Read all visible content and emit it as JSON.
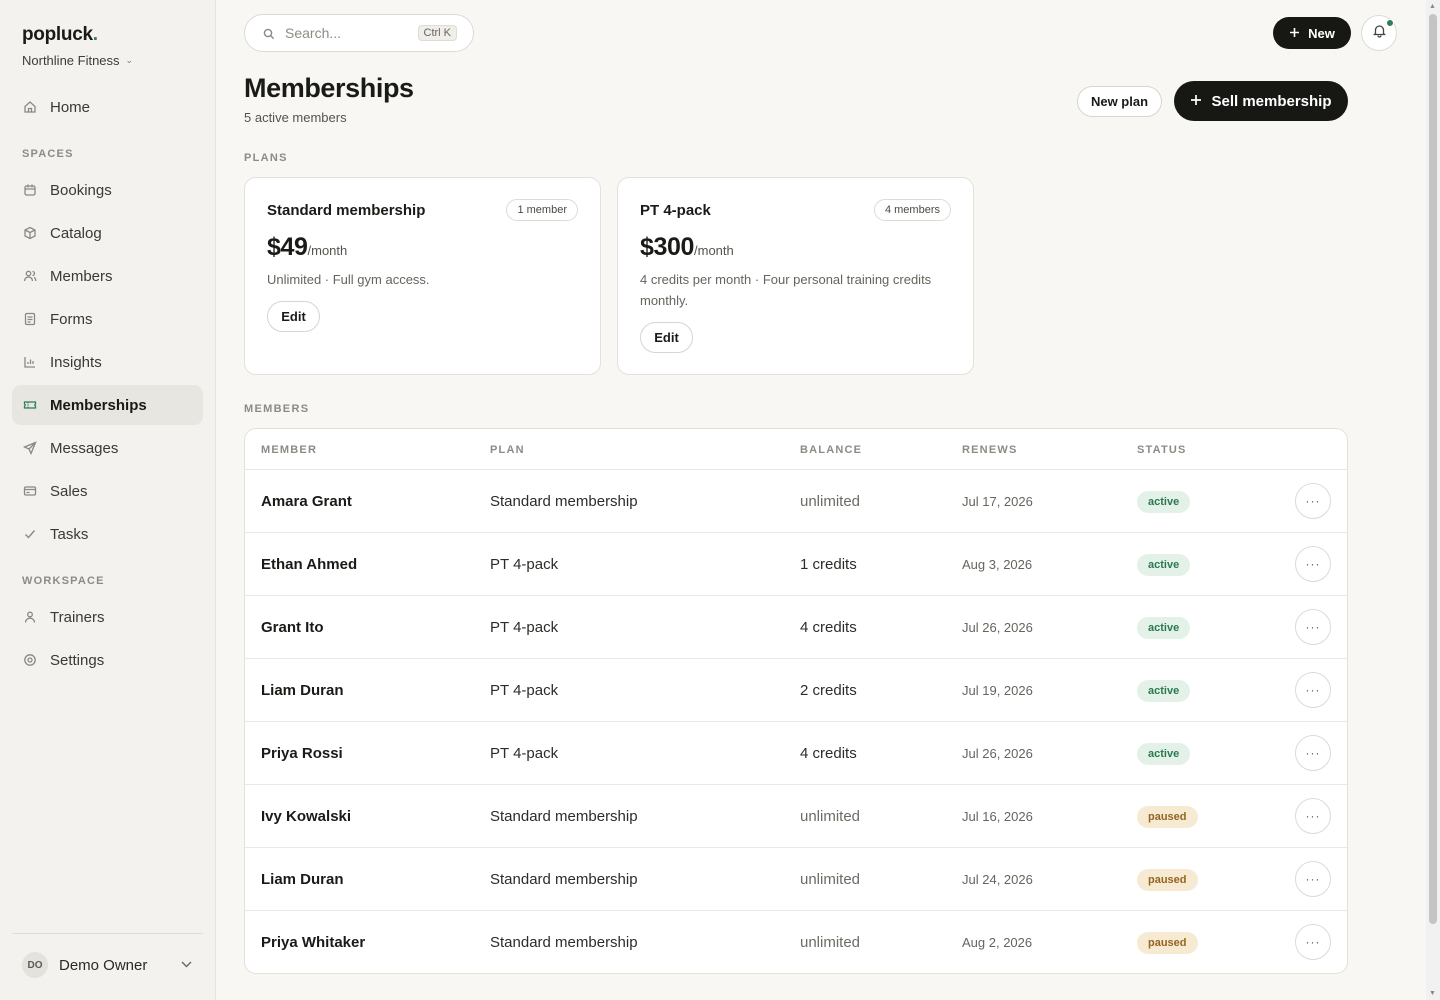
{
  "brand": {
    "name": "popluck",
    "dot": "."
  },
  "org": {
    "name": "Northline Fitness"
  },
  "nav": {
    "home": "Home",
    "spaces_label": "SPACES",
    "spaces": [
      "Bookings",
      "Catalog",
      "Members",
      "Forms",
      "Insights",
      "Memberships",
      "Messages",
      "Sales",
      "Tasks"
    ],
    "workspace_label": "WORKSPACE",
    "workspace": [
      "Trainers",
      "Settings"
    ],
    "active": "Memberships"
  },
  "user": {
    "initials": "DO",
    "name": "Demo Owner"
  },
  "topbar": {
    "search_placeholder": "Search...",
    "shortcut": "Ctrl K",
    "new_label": "New"
  },
  "header": {
    "title": "Memberships",
    "subtitle": "5 active members",
    "new_plan_label": "New plan",
    "sell_label": "Sell membership"
  },
  "plans_label": "PLANS",
  "plans": [
    {
      "name": "Standard membership",
      "badge": "1 member",
      "price": "$49",
      "period": "/month",
      "description": "Unlimited · Full gym access.",
      "edit_label": "Edit"
    },
    {
      "name": "PT 4-pack",
      "badge": "4 members",
      "price": "$300",
      "period": "/month",
      "description": "4 credits per month · Four personal training credits monthly.",
      "edit_label": "Edit"
    }
  ],
  "members_label": "MEMBERS",
  "table": {
    "columns": [
      "MEMBER",
      "PLAN",
      "BALANCE",
      "RENEWS",
      "STATUS"
    ],
    "rows": [
      {
        "member": "Amara Grant",
        "plan": "Standard membership",
        "balance": "unlimited",
        "renews": "Jul 17, 2026",
        "status": "active"
      },
      {
        "member": "Ethan Ahmed",
        "plan": "PT 4-pack",
        "balance": "1 credits",
        "renews": "Aug 3, 2026",
        "status": "active"
      },
      {
        "member": "Grant Ito",
        "plan": "PT 4-pack",
        "balance": "4 credits",
        "renews": "Jul 26, 2026",
        "status": "active"
      },
      {
        "member": "Liam Duran",
        "plan": "PT 4-pack",
        "balance": "2 credits",
        "renews": "Jul 19, 2026",
        "status": "active"
      },
      {
        "member": "Priya Rossi",
        "plan": "PT 4-pack",
        "balance": "4 credits",
        "renews": "Jul 26, 2026",
        "status": "active"
      },
      {
        "member": "Ivy Kowalski",
        "plan": "Standard membership",
        "balance": "unlimited",
        "renews": "Jul 16, 2026",
        "status": "paused"
      },
      {
        "member": "Liam Duran",
        "plan": "Standard membership",
        "balance": "unlimited",
        "renews": "Jul 24, 2026",
        "status": "paused"
      },
      {
        "member": "Priya Whitaker",
        "plan": "Standard membership",
        "balance": "unlimited",
        "renews": "Aug 2, 2026",
        "status": "paused"
      }
    ],
    "row_action_icon": "more-horizontal-icon"
  },
  "colors": {
    "accent": "#2f7d5b",
    "primary_button": "#171714",
    "active_pill_bg": "#e3f1e8",
    "active_pill_text": "#2b7a4f",
    "paused_pill_bg": "#f7ead3",
    "paused_pill_text": "#94651e"
  }
}
